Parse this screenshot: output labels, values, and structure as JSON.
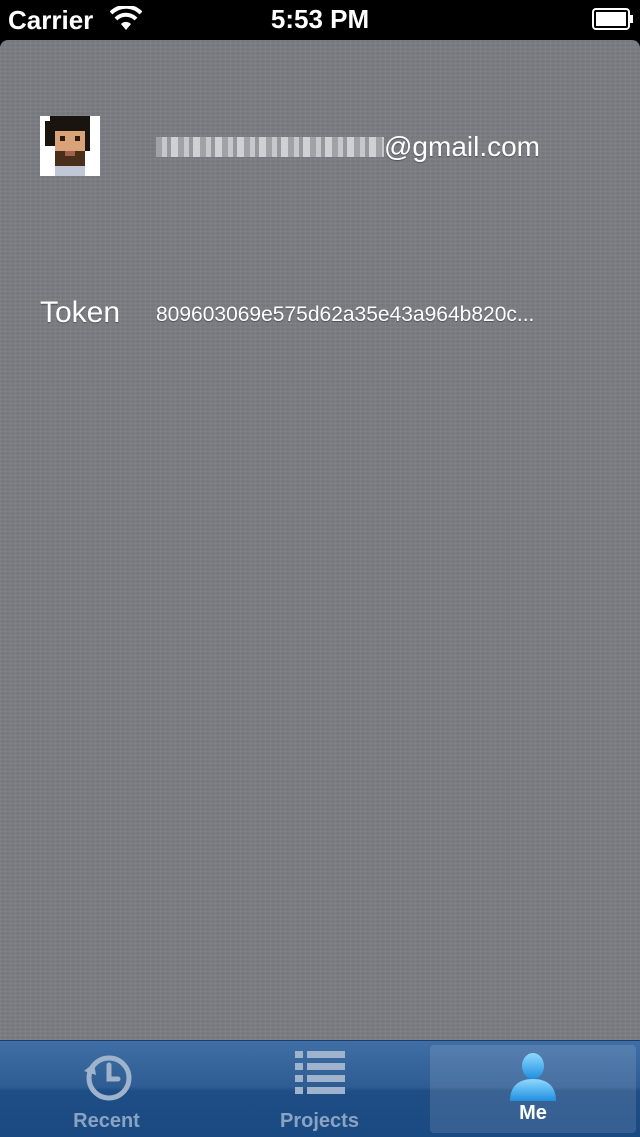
{
  "status_bar": {
    "carrier": "Carrier",
    "time": "5:53 PM"
  },
  "profile": {
    "email_domain": "@gmail.com",
    "token_label": "Token",
    "token_value": "809603069e575d62a35e43a964b820c..."
  },
  "tabs": [
    {
      "label": "Recent",
      "icon": "history-icon",
      "selected": false
    },
    {
      "label": "Projects",
      "icon": "list-icon",
      "selected": false
    },
    {
      "label": "Me",
      "icon": "person-icon",
      "selected": true
    }
  ],
  "colors": {
    "tab_bar": "#2e5c93",
    "tab_selected_icon": "#3ab0f0",
    "background": "#7a7c82"
  }
}
